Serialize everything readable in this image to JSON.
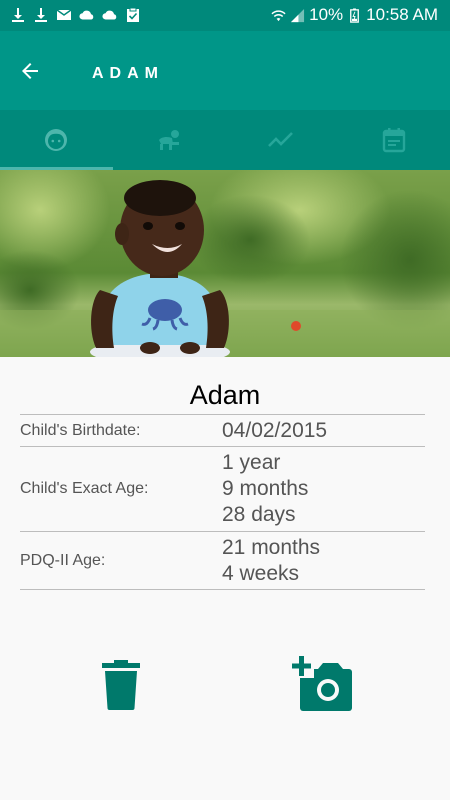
{
  "status_bar": {
    "battery_percent": "10%",
    "time": "10:58 AM",
    "icons": [
      "download-icon",
      "download-icon",
      "email-icon",
      "cloud-icon",
      "cloud-icon",
      "clipboard-check-icon",
      "wifi-icon",
      "signal-icon",
      "battery-icon"
    ]
  },
  "app_bar": {
    "title": "ADAM",
    "back_icon": "arrow-back-icon"
  },
  "tabs": [
    {
      "name": "profile",
      "icon": "child-face-icon",
      "selected": true
    },
    {
      "name": "milestones",
      "icon": "crawling-baby-icon",
      "selected": false
    },
    {
      "name": "growth",
      "icon": "trend-line-icon",
      "selected": false
    },
    {
      "name": "calendar",
      "icon": "calendar-icon",
      "selected": false
    }
  ],
  "colors": {
    "status_bar": "#00897b",
    "app_bar": "#009688",
    "tab_bar": "#00897b",
    "accent": "#00796b",
    "tab_indicator": "#4db6ac"
  },
  "profile": {
    "name": "Adam",
    "rows": [
      {
        "label": "Child's Birthdate:",
        "values": [
          "04/02/2015"
        ]
      },
      {
        "label": "Child's Exact Age:",
        "values": [
          "1 year",
          "9 months",
          "28 days"
        ]
      },
      {
        "label": "PDQ-II Age:",
        "values": [
          "21 months",
          "4 weeks"
        ]
      }
    ]
  },
  "actions": {
    "delete_icon": "trash-icon",
    "photo_icon": "add-photo-icon"
  }
}
